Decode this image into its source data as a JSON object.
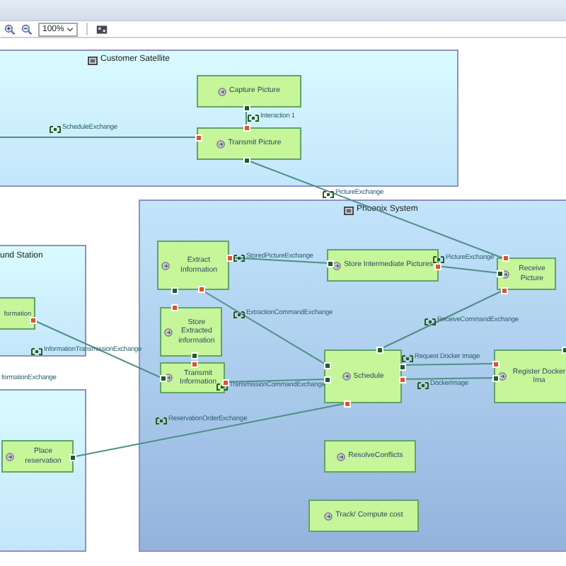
{
  "toolbar": {
    "zoom": "100%"
  },
  "containers": [
    {
      "kind": "actor",
      "title": "Customer Satellite"
    },
    {
      "kind": "actor",
      "title": "und Station"
    },
    {
      "kind": "actor"
    },
    {
      "kind": "system",
      "title": "Phoenix System"
    }
  ],
  "functions": [
    {
      "label": "Capture Picture"
    },
    {
      "label": "Transmit Picture"
    },
    {
      "label": "formation"
    },
    {
      "label": "Place reservation"
    },
    {
      "label": "Extract Information"
    },
    {
      "label": "Store Extracted information"
    },
    {
      "label": "Transmit Information"
    },
    {
      "label": "Store Intermediate Pictures"
    },
    {
      "label": "Receive Picture"
    },
    {
      "label": "Schedule"
    },
    {
      "label": "Register Docker Ima"
    },
    {
      "label": "ResolveConflicts"
    },
    {
      "label": "Track/ Compute cost"
    }
  ],
  "exchanges": [
    {
      "label": "ScheduleExchange"
    },
    {
      "label": "Interaction 1"
    },
    {
      "label": "PictureExchange"
    },
    {
      "label": "StoredPictureExchange"
    },
    {
      "label": "PictureExchange"
    },
    {
      "label": "InformationTransmissionExchange"
    },
    {
      "label": "formationExchange"
    },
    {
      "label": "ExtractionCommandExchange"
    },
    {
      "label": "ReceiveCommandExchange"
    },
    {
      "label": "TransmissionCommandExchange"
    },
    {
      "label": "Request Docker Image"
    },
    {
      "label": "DockerImage"
    },
    {
      "label": "ReservationOrderExchange"
    }
  ]
}
